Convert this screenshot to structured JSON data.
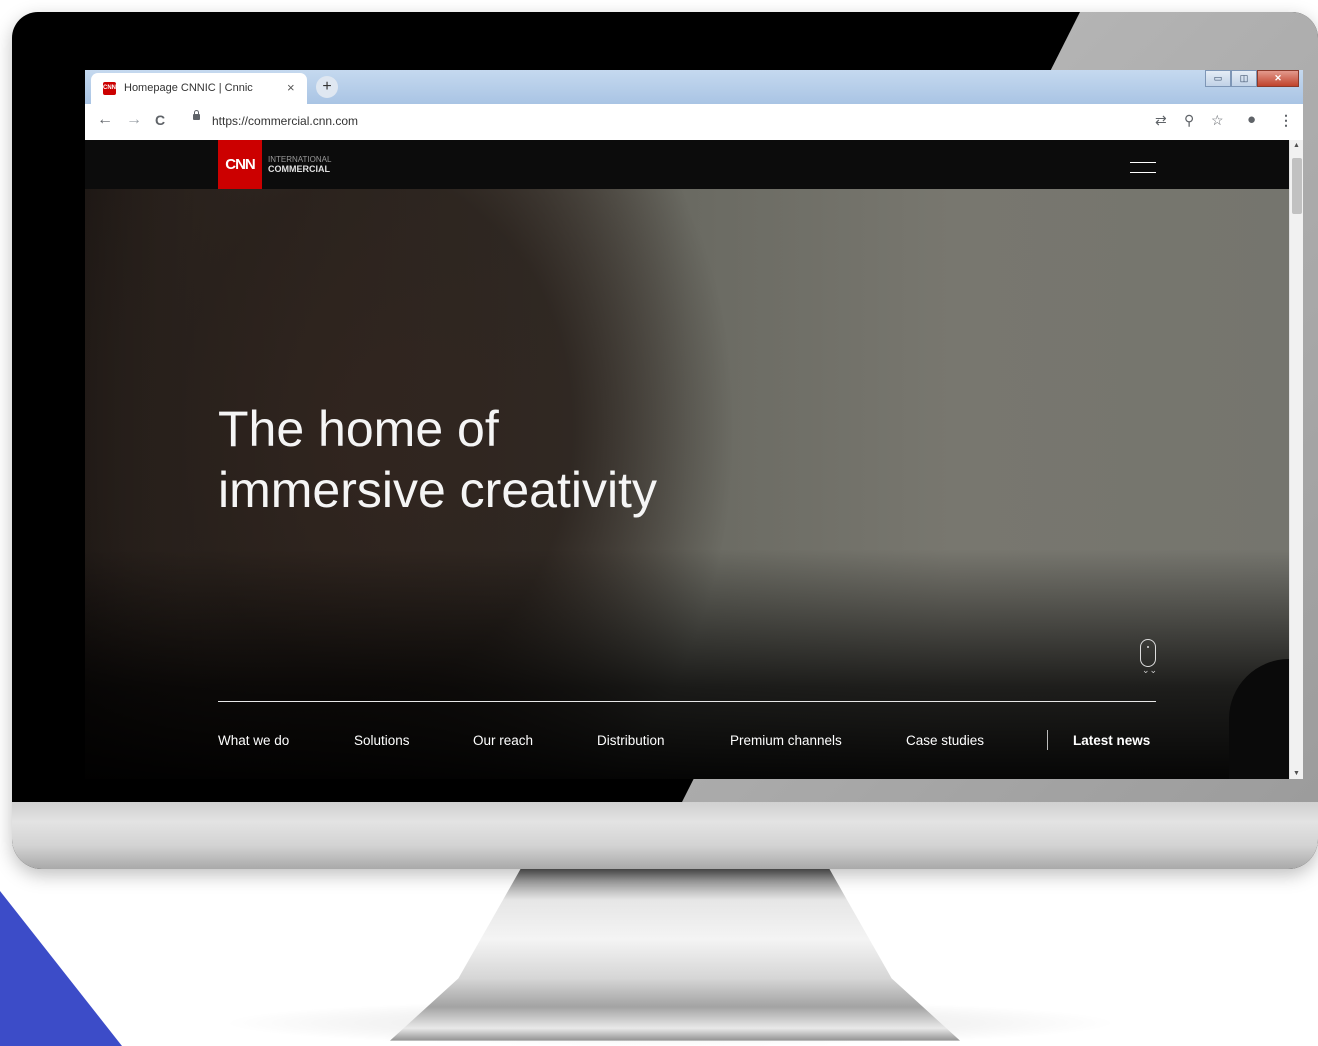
{
  "browser": {
    "tab_title": "Homepage CNNIC | Cnnic",
    "tab_close": "×",
    "new_tab": "+",
    "favicon_text": "CNN",
    "url": "https://commercial.cnn.com",
    "window_controls": {
      "minimize": "▭",
      "maximize": "◫",
      "close": "✕"
    },
    "nav_icons": {
      "back": "←",
      "forward": "→",
      "reload": "C"
    },
    "toolbar_icons": {
      "translate": "⇄",
      "zoom": "⚲",
      "bookmark": "☆",
      "account": "●",
      "menu": "⋮"
    }
  },
  "site": {
    "logo_text": "CNN",
    "brand_line1": "INTERNATIONAL",
    "brand_line2": "COMMERCIAL"
  },
  "hero": {
    "headline_line1": "The home of",
    "headline_line2": "immersive creativity",
    "scroll_chevrons": "⌄⌄"
  },
  "nav": {
    "items": [
      "What we do",
      "Solutions",
      "Our reach",
      "Distribution",
      "Premium channels",
      "Case studies"
    ],
    "latest": "Latest news"
  },
  "scrollbar": {
    "up": "▲",
    "down": "▼"
  },
  "colors": {
    "brand_red": "#cc0000",
    "corner_accent": "#3c4cc8",
    "header_bg": "#0c0c0c"
  }
}
